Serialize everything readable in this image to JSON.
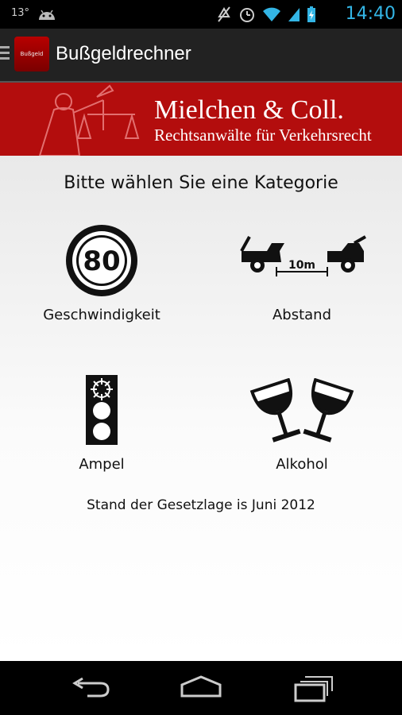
{
  "status_bar": {
    "temperature": "13°",
    "time": "14:40",
    "icons": [
      "android-icon",
      "mute-icon",
      "alarm-icon",
      "wifi-icon",
      "signal-icon",
      "battery-charging-icon"
    ]
  },
  "action_bar": {
    "title": "Bußgeldrechner",
    "icon_text": "Bußgeld"
  },
  "banner": {
    "firm_name": "Mielchen & Coll.",
    "subtitle": "Rechtsanwälte für Verkehrsrecht"
  },
  "main": {
    "heading": "Bitte wählen Sie eine Kategorie",
    "categories": [
      {
        "label": "Geschwindigkeit",
        "icon": "speed-limit-sign-icon",
        "sign_text": "80"
      },
      {
        "label": "Abstand",
        "icon": "distance-cars-icon",
        "distance_text": "10m"
      },
      {
        "label": "Ampel",
        "icon": "traffic-light-icon"
      },
      {
        "label": "Alkohol",
        "icon": "wine-glasses-icon"
      }
    ],
    "footer_note": "Stand der Gesetzlage is Juni 2012"
  },
  "nav_bar": {
    "buttons": [
      "back-icon",
      "home-icon",
      "recent-apps-icon"
    ]
  },
  "colors": {
    "banner_red": "#b30d0d",
    "time_blue": "#33b5e5",
    "action_bar": "#222222"
  }
}
